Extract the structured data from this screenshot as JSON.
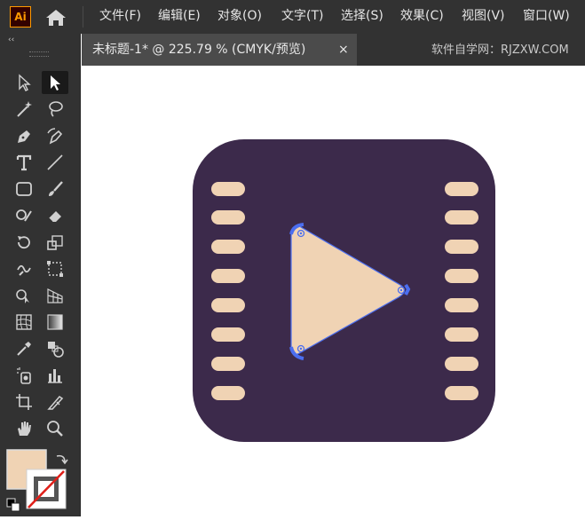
{
  "app": {
    "logo_text": "Ai",
    "menu": [
      "文件(F)",
      "编辑(E)",
      "对象(O)",
      "文字(T)",
      "选择(S)",
      "效果(C)",
      "视图(V)",
      "窗口(W)"
    ]
  },
  "panel": {
    "collapse_label": "‹‹"
  },
  "tools": [
    {
      "name": "selection-tool",
      "icon": "selection-arrow-icon"
    },
    {
      "name": "direct-selection-tool",
      "icon": "direct-selection-arrow-icon"
    },
    {
      "name": "magic-wand-tool",
      "icon": "magic-wand-icon"
    },
    {
      "name": "lasso-tool",
      "icon": "lasso-icon"
    },
    {
      "name": "pen-tool",
      "icon": "pen-icon"
    },
    {
      "name": "curvature-tool",
      "icon": "curvature-pen-icon"
    },
    {
      "name": "type-tool",
      "icon": "type-icon"
    },
    {
      "name": "line-segment-tool",
      "icon": "line-icon"
    },
    {
      "name": "rectangle-tool",
      "icon": "rounded-rectangle-icon"
    },
    {
      "name": "paintbrush-tool",
      "icon": "paintbrush-icon"
    },
    {
      "name": "shaper-tool",
      "icon": "shaper-icon"
    },
    {
      "name": "eraser-tool",
      "icon": "eraser-icon"
    },
    {
      "name": "rotate-tool",
      "icon": "rotate-icon"
    },
    {
      "name": "scale-tool",
      "icon": "scale-icon"
    },
    {
      "name": "warp-tool",
      "icon": "warp-icon"
    },
    {
      "name": "free-transform-tool",
      "icon": "free-transform-icon"
    },
    {
      "name": "shape-builder-tool",
      "icon": "shape-builder-icon"
    },
    {
      "name": "perspective-grid-tool",
      "icon": "perspective-grid-icon"
    },
    {
      "name": "mesh-tool",
      "icon": "mesh-icon"
    },
    {
      "name": "gradient-tool",
      "icon": "gradient-icon"
    },
    {
      "name": "eyedropper-tool",
      "icon": "eyedropper-icon"
    },
    {
      "name": "blend-tool",
      "icon": "blend-icon"
    },
    {
      "name": "symbol-sprayer-tool",
      "icon": "symbol-sprayer-icon"
    },
    {
      "name": "column-graph-tool",
      "icon": "column-graph-icon"
    },
    {
      "name": "artboard-tool",
      "icon": "artboard-icon"
    },
    {
      "name": "slice-tool",
      "icon": "slice-knife-icon"
    },
    {
      "name": "hand-tool",
      "icon": "hand-icon"
    },
    {
      "name": "zoom-tool",
      "icon": "magnifier-icon"
    }
  ],
  "active_tool": "direct-selection-tool",
  "colors": {
    "fill": "#f0d3b4",
    "stroke": "none",
    "icon_bg": "#3c2a4b",
    "selection": "#4b6ef0",
    "ui_dark": "#323232"
  },
  "document": {
    "tab_title": "未标题-1* @ 225.79 % (CMYK/预览)",
    "close_label": "×",
    "watermark": "软件自学网：RJZXW.COM"
  }
}
